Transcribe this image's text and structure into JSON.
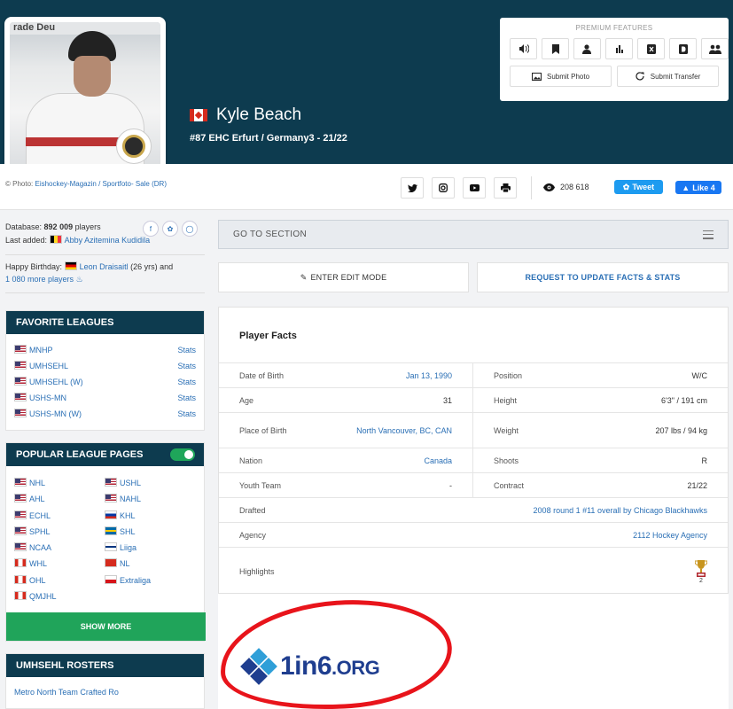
{
  "header": {
    "player_name": "Kyle Beach",
    "player_sub": "#87 EHC Erfurt / Germany3 - 21/22",
    "photo_banner": "rade Deu",
    "photo_credit_prefix": "© Photo:",
    "photo_credit_link": "Eishockey-Magazin / Sportfoto- Sale (DR)"
  },
  "premium": {
    "title": "PREMIUM FEATURES",
    "icons": [
      "speaker-icon",
      "bookmark-icon",
      "user-compare-icon",
      "chart-icon",
      "x-icon",
      "d-icon",
      "users-icon"
    ],
    "submit_photo": "Submit Photo",
    "submit_transfer": "Submit Transfer"
  },
  "share": {
    "views": "208 618",
    "tweet": "Tweet",
    "like": "Like 4"
  },
  "sidebar": {
    "db_label": "Database:",
    "db_count": "892 009",
    "db_suffix": "players",
    "last_added_label": "Last added:",
    "last_added_name": "Abby Azitemina Kudidila",
    "bday_label": "Happy Birthday:",
    "bday_name": "Leon Draisaitl",
    "bday_age": "(26 yrs) and",
    "bday_more": "1 080 more players",
    "favorite_title": "FAVORITE LEAGUES",
    "favorites": [
      {
        "name": "MNHP",
        "stats": "Stats"
      },
      {
        "name": "UMHSEHL",
        "stats": "Stats"
      },
      {
        "name": "UMHSEHL (W)",
        "stats": "Stats"
      },
      {
        "name": "USHS-MN",
        "stats": "Stats"
      },
      {
        "name": "USHS-MN (W)",
        "stats": "Stats"
      }
    ],
    "popular_title": "POPULAR LEAGUE PAGES",
    "popular": [
      "NHL",
      "USHL",
      "AHL",
      "NAHL",
      "ECHL",
      "KHL",
      "SPHL",
      "SHL",
      "NCAA",
      "Liiga",
      "WHL",
      "NL",
      "OHL",
      "Extraliga",
      "QMJHL"
    ],
    "show_more": "SHOW MORE",
    "rosters_title": "UMHSEHL ROSTERS",
    "rosters_row": "Metro North                Team Crafted Ro"
  },
  "main": {
    "goto": "GO TO SECTION",
    "edit_mode": "ENTER EDIT MODE",
    "request_update": "REQUEST TO UPDATE FACTS & STATS",
    "facts_title": "Player Facts",
    "facts": {
      "dob_k": "Date of Birth",
      "dob_v": "Jan 13, 1990",
      "pos_k": "Position",
      "pos_v": "W/C",
      "age_k": "Age",
      "age_v": "31",
      "height_k": "Height",
      "height_v": "6'3\" / 191 cm",
      "pob_k": "Place of Birth",
      "pob_v": "North Vancouver, BC, CAN",
      "weight_k": "Weight",
      "weight_v": "207 lbs / 94 kg",
      "nation_k": "Nation",
      "nation_v": "Canada",
      "shoots_k": "Shoots",
      "shoots_v": "R",
      "youth_k": "Youth Team",
      "youth_v": "-",
      "contract_k": "Contract",
      "contract_v": "21/22",
      "drafted_k": "Drafted",
      "drafted_v": "2008 round 1 #11 overall by Chicago Blackhawks",
      "agency_k": "Agency",
      "agency_v": "2112 Hockey Agency",
      "highlights_k": "Highlights",
      "highlights_count": "2"
    }
  },
  "ad": {
    "brand_main": "1in6",
    "brand_suffix": ".ORG"
  },
  "colors": {
    "header_bg": "#0d3b4f",
    "link": "#2a6fb5",
    "green": "#20a45a",
    "ad_red": "#e8141b",
    "ad_blue": "#1f3e8f"
  }
}
